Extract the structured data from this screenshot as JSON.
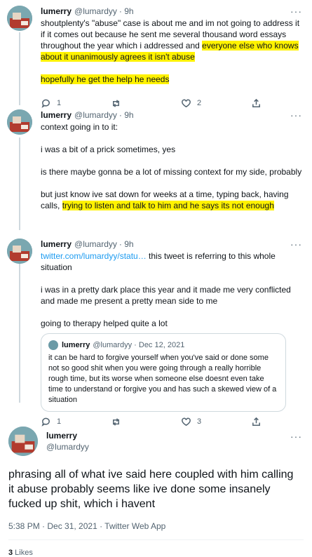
{
  "tweets": [
    {
      "name": "lumerry",
      "handle": "@lumardyy",
      "time": "· 9h",
      "text_a": "shoutplenty's \"abuse\" case is about me and im not going to address it if it comes out because he sent me several thousand word essays throughout the year which i addressed and ",
      "text_hl1": "everyone else who knows about it unanimously agrees it isn't abuse",
      "text_hl2": "hopefully he get the help he needs",
      "replies": "1",
      "likes": "2"
    },
    {
      "name": "lumerry",
      "handle": "@lumardyy",
      "time": "· 9h",
      "p1": "context going in to it:",
      "p2": "i was a bit of a prick sometimes, yes",
      "p3": "is there maybe gonna be a lot of missing context for my side, probably",
      "p4a": "but just know ive sat down for weeks at a time, typing back, having calls, ",
      "p4hl": "trying to listen and talk to him and he says its not enough"
    },
    {
      "name": "lumerry",
      "handle": "@lumardyy",
      "time": "· 9h",
      "link": "twitter.com/lumardyy/statu…",
      "link_rest": " this tweet is referring to this whole situation",
      "p2": "i was in a pretty dark place this year and it made me very conflicted and made me present a pretty mean side to me",
      "p3": "going to therapy helped quite a lot",
      "quote": {
        "name": "lumerry",
        "handle": "@lumardyy",
        "date": "· Dec 12, 2021",
        "text": "it can be hard to forgive yourself when you've said or done some not so good shit when you were going through a really horrible rough time, but its worse when someone else doesnt even take time to understand or forgive you and has such a skewed view of a situation"
      },
      "replies": "1",
      "likes": "3"
    }
  ],
  "main": {
    "name": "lumerry",
    "handle": "@lumardyy",
    "text": "phrasing all of what ive said here coupled with him calling it abuse probably seems like ive done some insanely fucked up shit, which i havent",
    "timestamp": "5:38 PM · Dec 31, 2021 · Twitter Web App",
    "likes_count": "3",
    "likes_label": " Likes"
  },
  "more_glyph": "···"
}
